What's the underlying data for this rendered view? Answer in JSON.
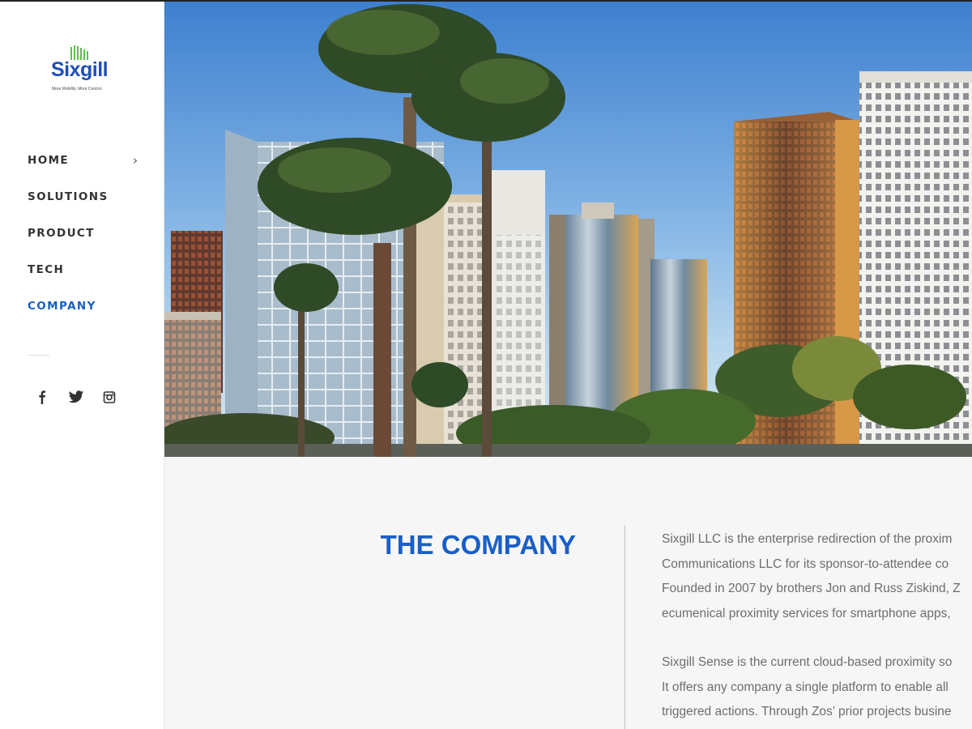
{
  "brand": {
    "name": "Sixgill",
    "tagline": "More Mobility. More Control.",
    "bar_color": "#5cc04a",
    "name_color": "#1f4fb5"
  },
  "nav": {
    "items": [
      {
        "label": "HOME",
        "has_submenu": true
      },
      {
        "label": "SOLUTIONS"
      },
      {
        "label": "PRODUCT"
      },
      {
        "label": "TECH"
      },
      {
        "label": "COMPANY",
        "active": true
      }
    ],
    "submenu_glyph": "›",
    "active_color": "#1a5fc7"
  },
  "social": [
    "facebook-icon",
    "twitter-icon",
    "instagram-icon"
  ],
  "hero": {
    "subject": "downtown skyline with palm trees"
  },
  "section": {
    "title": "THE COMPANY",
    "title_color": "#1a5fc7",
    "paragraphs": [
      [
        "Sixgill LLC is the enterprise redirection of the proxim",
        "Communications LLC for its sponsor-to-attendee co",
        "Founded in 2007 by brothers Jon and Russ Ziskind, Z",
        "ecumenical proximity services for smartphone apps,"
      ],
      [
        "Sixgill Sense is the current cloud-based proximity so",
        "It offers any company a single platform to enable all",
        "triggered actions. Through Zos’ prior projects busine"
      ]
    ]
  }
}
